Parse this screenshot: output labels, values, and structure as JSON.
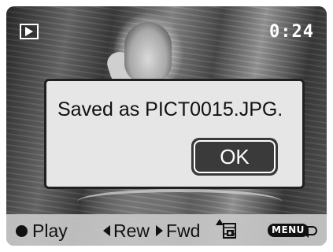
{
  "screen": {
    "timer": "0:24",
    "play_mode_icon": "playback-icon"
  },
  "dialog": {
    "message": "Saved as PICT0015.JPG.",
    "ok_label": "OK"
  },
  "bottom_bar": {
    "play_label": "Play",
    "rew_label": "Rew",
    "fwd_label": "Fwd",
    "frame_icon": "frame-capture-icon",
    "menu_label": "MENU",
    "return_icon": "return-icon"
  }
}
